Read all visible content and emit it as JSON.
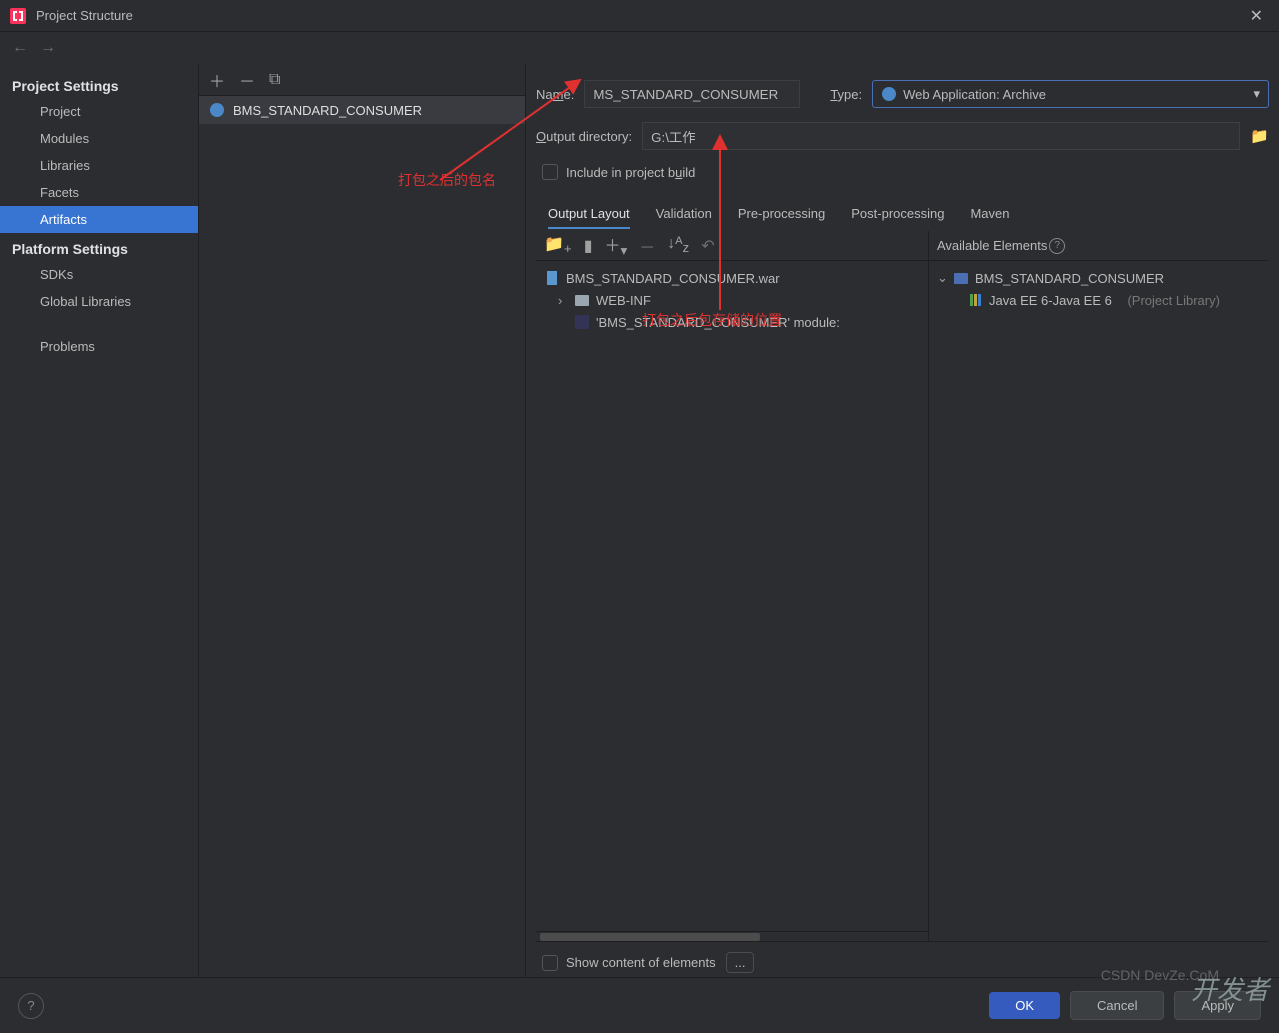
{
  "window": {
    "title": "Project Structure"
  },
  "sidebar": {
    "sections": [
      {
        "title": "Project Settings",
        "items": [
          "Project",
          "Modules",
          "Libraries",
          "Facets",
          "Artifacts"
        ]
      },
      {
        "title": "Platform Settings",
        "items": [
          "SDKs",
          "Global Libraries"
        ]
      },
      {
        "title_empty": "",
        "items": [
          "Problems"
        ]
      }
    ],
    "selected": "Artifacts"
  },
  "artifact_list": {
    "items": [
      "BMS_STANDARD_CONSUMER"
    ]
  },
  "form": {
    "name_label": "Name:",
    "name_value": "MS_STANDARD_CONSUMER",
    "type_label": "Type:",
    "type_value": "Web Application: Archive",
    "outdir_label": "Output directory:",
    "outdir_value": "G:\\工作",
    "include_label": "Include in project build"
  },
  "tabs": [
    "Output Layout",
    "Validation",
    "Pre-processing",
    "Post-processing",
    "Maven"
  ],
  "active_tab": "Output Layout",
  "output_tree": {
    "root": "BMS_STANDARD_CONSUMER.war",
    "webinf": "WEB-INF",
    "module": "'BMS_STANDARD_CONSUMER' module:"
  },
  "available": {
    "header": "Available Elements",
    "module": "BMS_STANDARD_CONSUMER",
    "lib_main": "Java EE 6-Java EE 6",
    "lib_suffix": "(Project Library)"
  },
  "show_content": {
    "label": "Show content of elements",
    "dots": "..."
  },
  "footer": {
    "ok": "OK",
    "cancel": "Cancel",
    "apply": "Apply"
  },
  "annotations": {
    "name": "打包之后的包名",
    "outdir": "打包之后包存储的位置"
  },
  "watermark": {
    "brand": "开发者",
    "sub": "CSDN DevZe.CoM"
  }
}
